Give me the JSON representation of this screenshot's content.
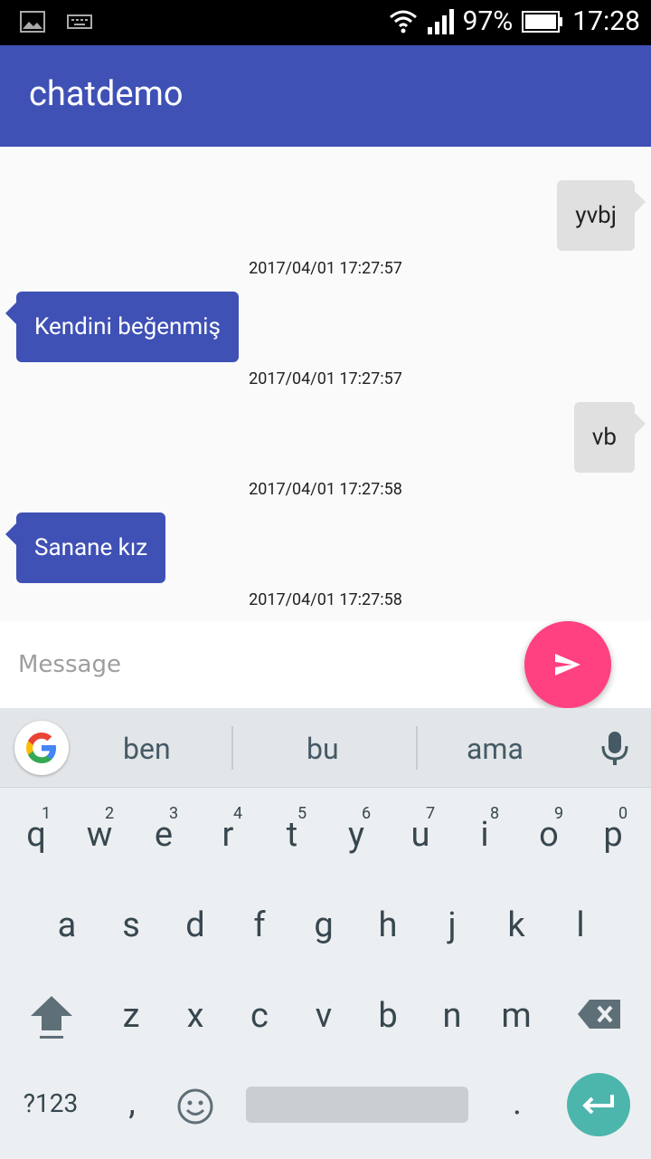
{
  "status": {
    "battery": "97%",
    "time": "17:28"
  },
  "app": {
    "title": "chatdemo"
  },
  "messages": [
    {
      "side": "out",
      "text": "yvbj",
      "timestamp": "2017/04/01 17:27:57"
    },
    {
      "side": "in",
      "text": "Kendini beğenmiş",
      "timestamp": "2017/04/01 17:27:57"
    },
    {
      "side": "out",
      "text": "vb",
      "timestamp": "2017/04/01 17:27:58"
    },
    {
      "side": "in",
      "text": "Sanane kız",
      "timestamp": "2017/04/01 17:27:58"
    }
  ],
  "composer": {
    "placeholder": "Message",
    "send_icon": "send-icon"
  },
  "keyboard": {
    "suggestions": [
      "ben",
      "bu",
      "ama"
    ],
    "row1": [
      "q",
      "w",
      "e",
      "r",
      "t",
      "y",
      "u",
      "i",
      "o",
      "p"
    ],
    "row1_nums": [
      "1",
      "2",
      "3",
      "4",
      "5",
      "6",
      "7",
      "8",
      "9",
      "0"
    ],
    "row2": [
      "a",
      "s",
      "d",
      "f",
      "g",
      "h",
      "j",
      "k",
      "l"
    ],
    "row3": [
      "z",
      "x",
      "c",
      "v",
      "b",
      "n",
      "m"
    ],
    "symbols_label": "?123",
    "comma": ",",
    "period": "."
  },
  "colors": {
    "appbar": "#3f51b5",
    "fab": "#ff4081",
    "enter": "#4db6ac"
  }
}
